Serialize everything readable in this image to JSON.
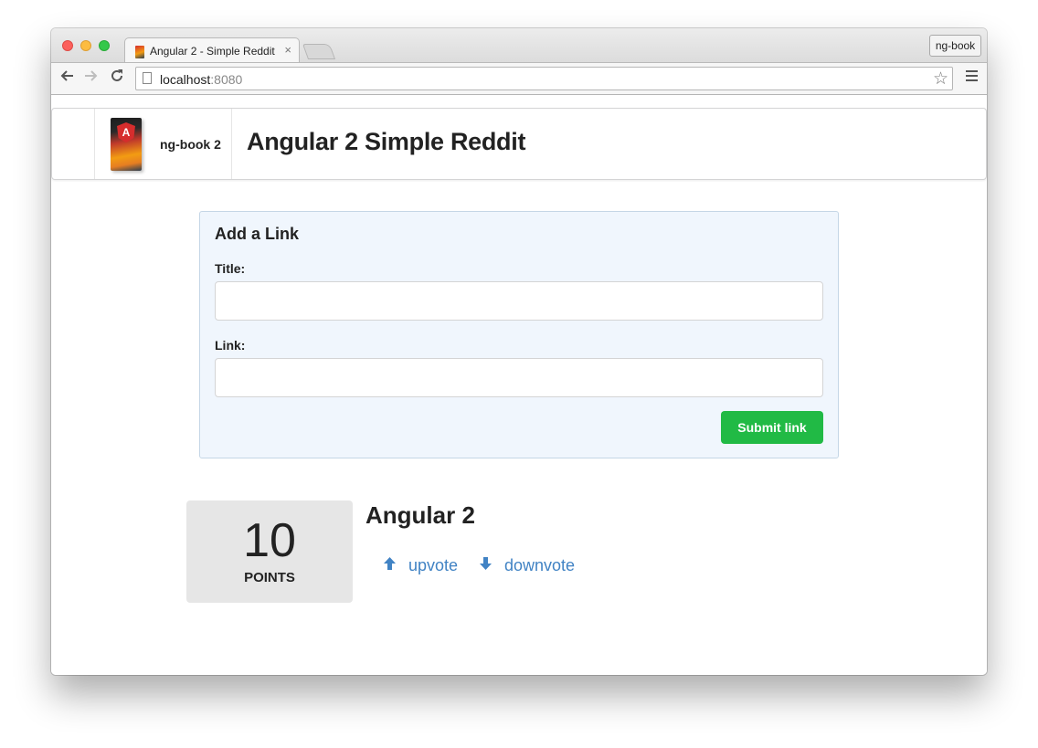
{
  "browser": {
    "tab_title": "Angular 2 - Simple Reddit",
    "tab_close": "×",
    "profile_label": "ng-book",
    "url_host": "localhost",
    "url_port": ":8080",
    "star_icon": "☆"
  },
  "navbar": {
    "brand": "ng-book 2",
    "book_letter": "A",
    "title": "Angular 2 Simple Reddit"
  },
  "form": {
    "heading": "Add a Link",
    "title_label": "Title:",
    "title_value": "",
    "link_label": "Link:",
    "link_value": "",
    "submit_label": "Submit link"
  },
  "article": {
    "votes": "10",
    "points_label": "POINTS",
    "title": "Angular 2",
    "upvote_icon": "🡅",
    "upvote_label": "upvote",
    "downvote_icon": "🡇",
    "downvote_label": "downvote"
  },
  "colors": {
    "submit": "#21ba45",
    "link": "#4183c4",
    "form_bg": "#f0f6fd",
    "score_bg": "#e6e6e6"
  }
}
